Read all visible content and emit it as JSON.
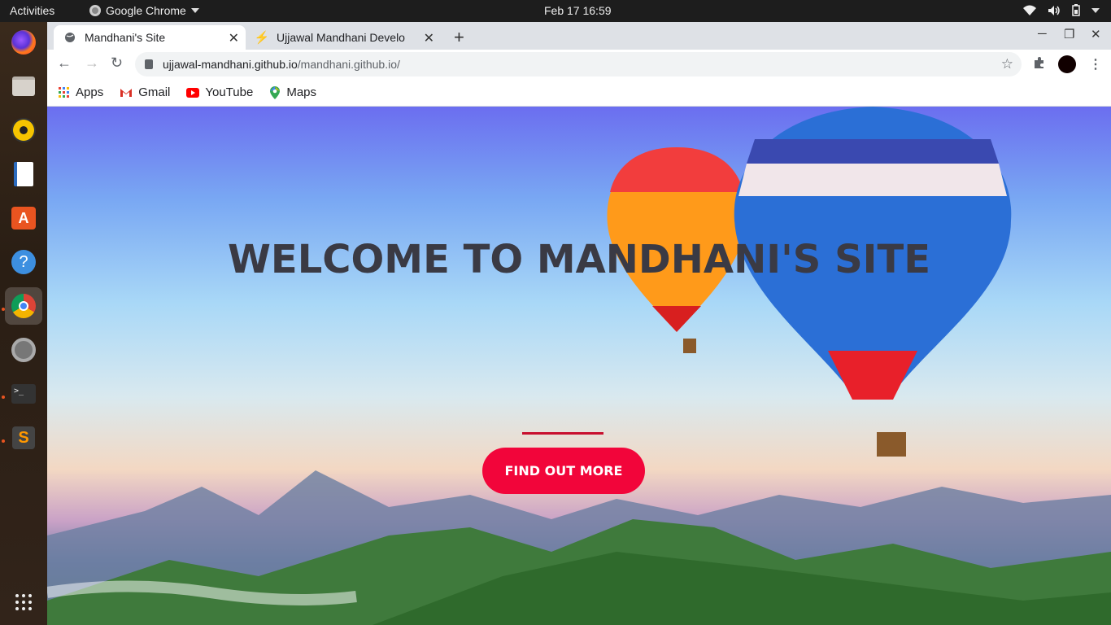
{
  "system": {
    "activities": "Activities",
    "app_name": "Google Chrome",
    "clock": "Feb 17  16:59"
  },
  "dock": {
    "apps": [
      "firefox-icon",
      "files-icon",
      "rhythmbox-icon",
      "libreoffice-writer-icon",
      "software-center-icon",
      "help-icon",
      "chrome-icon",
      "settings-icon",
      "terminal-icon",
      "sublime-text-icon",
      "app-grid-icon"
    ]
  },
  "browser": {
    "tabs": [
      {
        "label": "Mandhani's Site",
        "active": true
      },
      {
        "label": "Ujjawal Mandhani Develo",
        "active": false
      }
    ],
    "url_host": "ujjawal-mandhani.github.io",
    "url_path": "/mandhani.github.io/",
    "bookmarks": [
      {
        "label": "Apps",
        "icon": "apps-grid-icon"
      },
      {
        "label": "Gmail",
        "icon": "gmail-icon"
      },
      {
        "label": "YouTube",
        "icon": "youtube-icon"
      },
      {
        "label": "Maps",
        "icon": "maps-icon"
      }
    ]
  },
  "page": {
    "hero_title": "WELCOME TO MANDHANI'S SITE",
    "cta_label": "FIND OUT MORE",
    "accent_color": "#f2053a"
  }
}
